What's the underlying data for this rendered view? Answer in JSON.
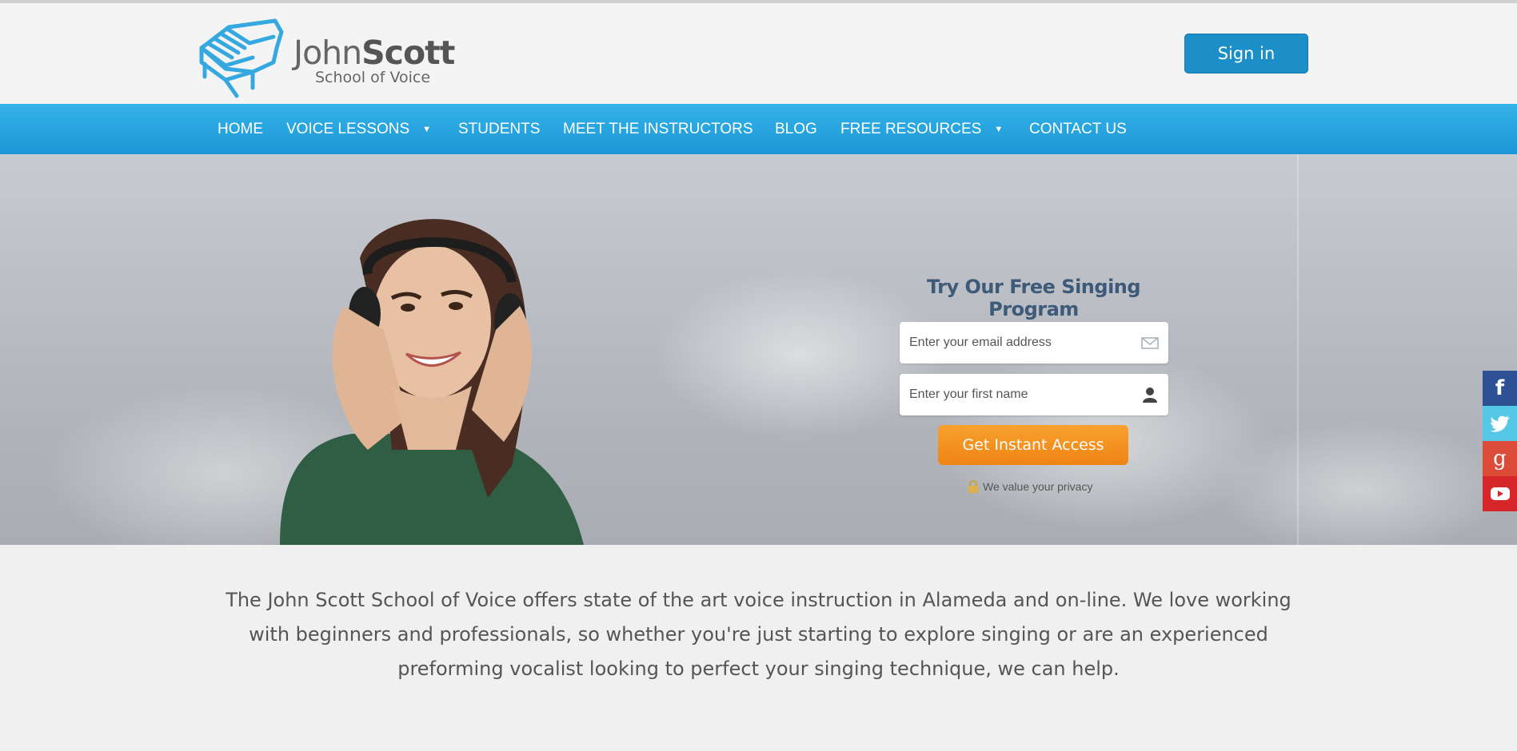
{
  "brand": {
    "name_first": "John",
    "name_last": "Scott",
    "subtitle": "School of Voice",
    "accent": "#35a9df"
  },
  "header": {
    "signin_label": "Sign in",
    "signin_color": "#1d8fc8"
  },
  "nav": {
    "items": [
      {
        "label": "HOME"
      },
      {
        "label": "VOICE LESSONS",
        "dropdown": true
      },
      {
        "label": "STUDENTS"
      },
      {
        "label": "MEET THE INSTRUCTORS"
      },
      {
        "label": "BLOG"
      },
      {
        "label": "FREE RESOURCES",
        "dropdown": true
      },
      {
        "label": "CONTACT US"
      }
    ],
    "caret": "▼",
    "color": "#1c98d6"
  },
  "optin": {
    "title": "Try Our Free Singing Program",
    "email_placeholder": "Enter your email address",
    "email_icon": "envelope-icon",
    "name_placeholder": "Enter your first name",
    "name_icon": "person-icon",
    "cta_label": "Get Instant Access",
    "cta_color": "#f39423",
    "privacy_text": "We value your privacy",
    "privacy_icon": "lock-icon"
  },
  "intro": {
    "text": "The John Scott School of Voice offers state of the art voice instruction in Alameda and on-line. We love working with beginners and professionals, so whether you're just starting to explore singing or are an experienced preforming vocalist looking to perfect your singing technique, we can help."
  },
  "social": [
    {
      "name": "facebook-icon",
      "glyph": "f",
      "color": "#2d4f93"
    },
    {
      "name": "twitter-icon",
      "glyph": "",
      "color": "#55c8e8"
    },
    {
      "name": "google-plus-icon",
      "glyph": "g",
      "color": "#dc4a38"
    },
    {
      "name": "youtube-icon",
      "glyph": "",
      "color": "#d7262a"
    }
  ]
}
